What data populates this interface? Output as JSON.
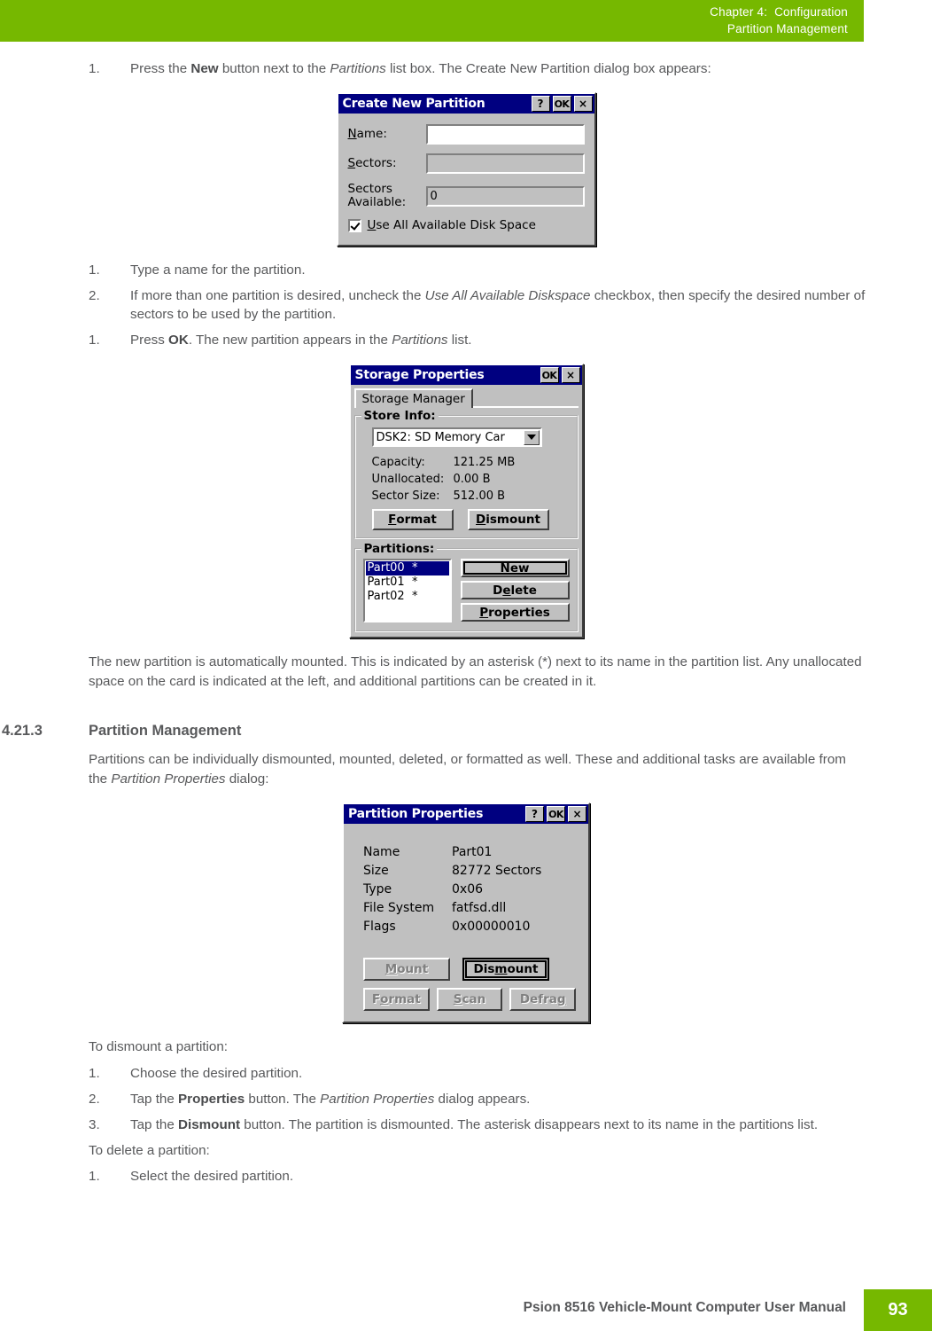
{
  "header": {
    "line1": "Chapter 4:  Configuration",
    "line2": "Partition Management",
    "bg": "#76b800"
  },
  "step1": {
    "num": "1.",
    "pre": "Press the ",
    "bold": "New",
    "mid": " button next to the ",
    "italic": "Partitions",
    "post": " list box. The Create New Partition dialog box appears:"
  },
  "create_new_partition_dialog": {
    "title": "Create New Partition",
    "help_btn": "?",
    "ok_btn": "OK",
    "close_btn": "×",
    "name_label": "Name:",
    "name_value": "",
    "sectors_label": "Sectors:",
    "sectors_value": "",
    "sectors_available_label_1": "Sectors",
    "sectors_available_label_2": "Available:",
    "sectors_available_value": "0",
    "checkbox_label": "Use All Available Disk Space",
    "checkbox_checked": true
  },
  "steps_mid": [
    {
      "num": "1.",
      "text": "Type a name for the partition."
    },
    {
      "num": "2.",
      "pre": "If more than one partition is desired, uncheck the ",
      "italic": "Use All Available Diskspace",
      "post": " checkbox, then specify the desired number of sectors to be used by the partition."
    },
    {
      "num": "1.",
      "pre": "Press ",
      "bold": "OK",
      "mid": ". The new partition appears in the ",
      "italic": "Partitions",
      "post": " list."
    }
  ],
  "storage_properties_dialog": {
    "title": "Storage Properties",
    "ok_btn": "OK",
    "close_btn": "×",
    "tab_label": "Storage Manager",
    "store_info_title": "Store Info:",
    "store_select_value": "DSK2: SD Memory Car",
    "info_rows": [
      {
        "key": "Capacity:",
        "value": "121.25 MB"
      },
      {
        "key": "Unallocated:",
        "value": "0.00 B"
      },
      {
        "key": "Sector Size:",
        "value": "512.00 B"
      }
    ],
    "format_btn": "Format",
    "dismount_btn": "Dismount",
    "partitions_title": "Partitions:",
    "partitions": [
      {
        "label": "Part00  *",
        "selected": true
      },
      {
        "label": "Part01  *",
        "selected": false
      },
      {
        "label": "Part02  *",
        "selected": false
      }
    ],
    "new_btn": "New",
    "delete_btn": "Delete",
    "properties_btn": "Properties"
  },
  "paragraph_mounted": "The new partition is automatically mounted. This is indicated by an asterisk (*) next to its name in the partition list. Any unallocated space on the card is indicated at the left, and additional partitions can be created in it.",
  "section": {
    "number": "4.21.3",
    "title": "Partition Management",
    "intro_pre": "Partitions can be individually dismounted, mounted, deleted, or formatted as well. These and additional tasks are available from the ",
    "intro_italic": "Partition Properties",
    "intro_post": " dialog:"
  },
  "partition_properties_dialog": {
    "title": "Partition Properties",
    "help_btn": "?",
    "ok_btn": "OK",
    "close_btn": "×",
    "rows": [
      {
        "key": "Name",
        "value": "Part01"
      },
      {
        "key": "Size",
        "value": "82772 Sectors"
      },
      {
        "key": "Type",
        "value": "0x06"
      },
      {
        "key": "File System",
        "value": "fatfsd.dll"
      },
      {
        "key": "Flags",
        "value": "0x00000010"
      }
    ],
    "mount_btn": "Mount",
    "dismount_btn": "Dismount",
    "format_btn": "Format",
    "scan_btn": "Scan",
    "defrag_btn": "Defrag"
  },
  "dismount_heading": "To dismount a partition:",
  "dismount_steps": [
    {
      "num": "1.",
      "text": "Choose the desired partition."
    },
    {
      "num": "2.",
      "pre": "Tap the ",
      "bold": "Properties",
      "mid": " button. The ",
      "italic": "Partition Properties",
      "post": " dialog appears."
    },
    {
      "num": "3.",
      "pre": "Tap the ",
      "bold": "Dismount",
      "post": " button. The partition is dismounted. The asterisk disappears next to its name in the partitions list."
    }
  ],
  "delete_heading": "To delete a partition:",
  "delete_steps": [
    {
      "num": "1.",
      "text": "Select the desired partition."
    }
  ],
  "footer": {
    "manual": "Psion 8516 Vehicle-Mount Computer User Manual",
    "page": "93",
    "bg": "#76b800"
  }
}
